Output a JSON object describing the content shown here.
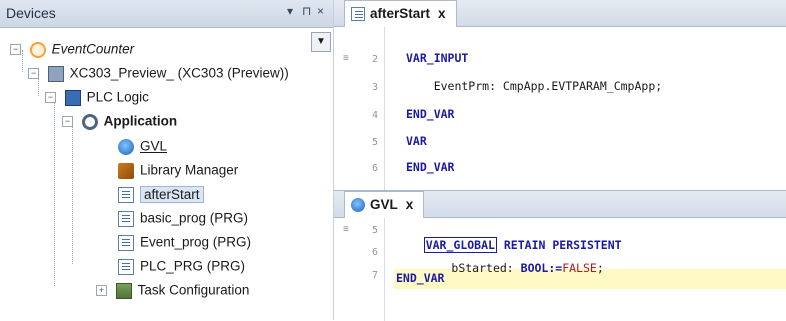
{
  "devices": {
    "title": "Devices",
    "controls": {
      "pin": "▾",
      "float": "⊓",
      "close": "×"
    },
    "tree": [
      {
        "label": "EventCounter",
        "icon": "event-counter-icon",
        "expander": "−"
      },
      {
        "label": "XC303_Preview_ (XC303 (Preview))",
        "icon": "device-icon",
        "expander": "−"
      },
      {
        "label": "PLC Logic",
        "icon": "plc-logic-icon",
        "expander": "−"
      },
      {
        "label": "Application",
        "icon": "application-icon",
        "expander": "−"
      },
      {
        "label": "GVL",
        "icon": "gvl-icon"
      },
      {
        "label": "Library Manager",
        "icon": "library-manager-icon"
      },
      {
        "label": "afterStart",
        "icon": "pou-icon"
      },
      {
        "label": "basic_prog (PRG)",
        "icon": "pou-icon"
      },
      {
        "label": "Event_prog (PRG)",
        "icon": "pou-icon"
      },
      {
        "label": "PLC_PRG (PRG)",
        "icon": "pou-icon"
      },
      {
        "label": "Task Configuration",
        "icon": "task-configuration-icon",
        "expander": "+"
      }
    ]
  },
  "editor_top": {
    "tab": {
      "label": "afterStart",
      "close": "x"
    },
    "lines": [
      {
        "n": "2",
        "text": "VAR_INPUT"
      },
      {
        "n": "3",
        "text": "    EventPrm: CmpApp.EVTPARAM_CmpApp;"
      },
      {
        "n": "4",
        "text": "END_VAR"
      },
      {
        "n": "5",
        "text": "VAR"
      },
      {
        "n": "6",
        "text": "END_VAR"
      }
    ]
  },
  "editor_bottom": {
    "tab": {
      "label": "GVL",
      "close": "x"
    },
    "lines": [
      {
        "n": "5",
        "kw1": "VAR_GLOBAL",
        "rest": " RETAIN PERSISTENT"
      },
      {
        "n": "6",
        "id": "    bStarted: ",
        "kw": "BOOL",
        "op": ":=",
        "val": "FALSE",
        "end": ";"
      },
      {
        "n": "7",
        "text": "END_VAR"
      }
    ]
  },
  "colors": {
    "keyword": "#1a1aa6",
    "literal": "#b01a1a",
    "current_line": "#fff9c4",
    "selection": "#dbe6f5"
  }
}
